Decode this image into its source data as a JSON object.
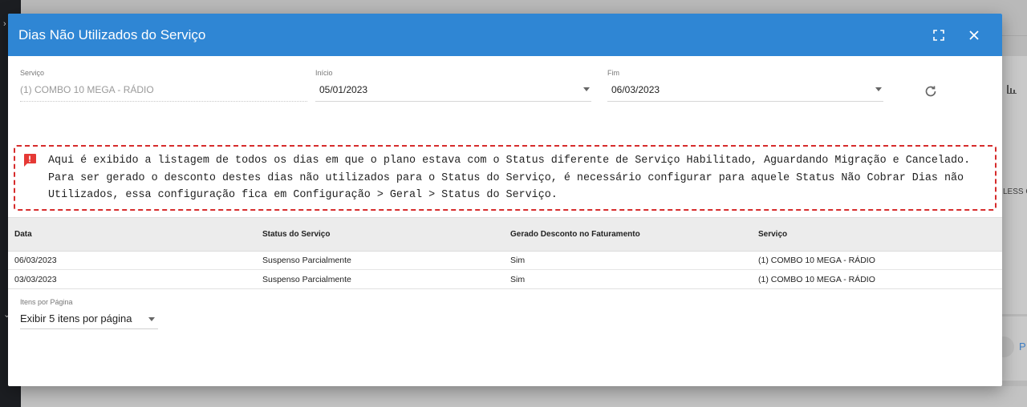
{
  "dialog": {
    "title": "Dias Não Utilizados do Serviço"
  },
  "filters": {
    "service_label": "Serviço",
    "service_value": "(1) COMBO 10 MEGA - RÁDIO",
    "start_label": "Início",
    "start_value": "05/01/2023",
    "end_label": "Fim",
    "end_value": "06/03/2023"
  },
  "notice": {
    "line1": "Aqui é exibido a listagem de todos os dias em que o plano estava com o Status diferente de Serviço Habilitado, Aguardando Migração e Cancelado.",
    "line2": "Para ser gerado o desconto destes dias não utilizados para o Status do Serviço, é necessário configurar para aquele Status Não Cobrar Dias não",
    "line3": "Utilizados, essa configuração fica em Configuração > Geral > Status do Serviço."
  },
  "table": {
    "headers": [
      "Data",
      "Status do Serviço",
      "Gerado Desconto no Faturamento",
      "Serviço"
    ],
    "rows": [
      [
        "06/03/2023",
        "Suspenso Parcialmente",
        "Sim",
        "(1) COMBO 10 MEGA - RÁDIO"
      ],
      [
        "03/03/2023",
        "Suspenso Parcialmente",
        "Sim",
        "(1) COMBO 10 MEGA - RÁDIO"
      ]
    ]
  },
  "pager": {
    "label": "Itens por Página",
    "value": "Exibir 5 itens por página"
  },
  "background": {
    "partial_text": "LESS C",
    "partial_link": "P"
  },
  "colors": {
    "header": "#2f86d4",
    "warning_border": "#d62c2c"
  },
  "icons": {
    "fullscreen": "fullscreen-icon",
    "close": "close-icon",
    "refresh": "refresh-icon",
    "warning": "alert-message-icon"
  }
}
